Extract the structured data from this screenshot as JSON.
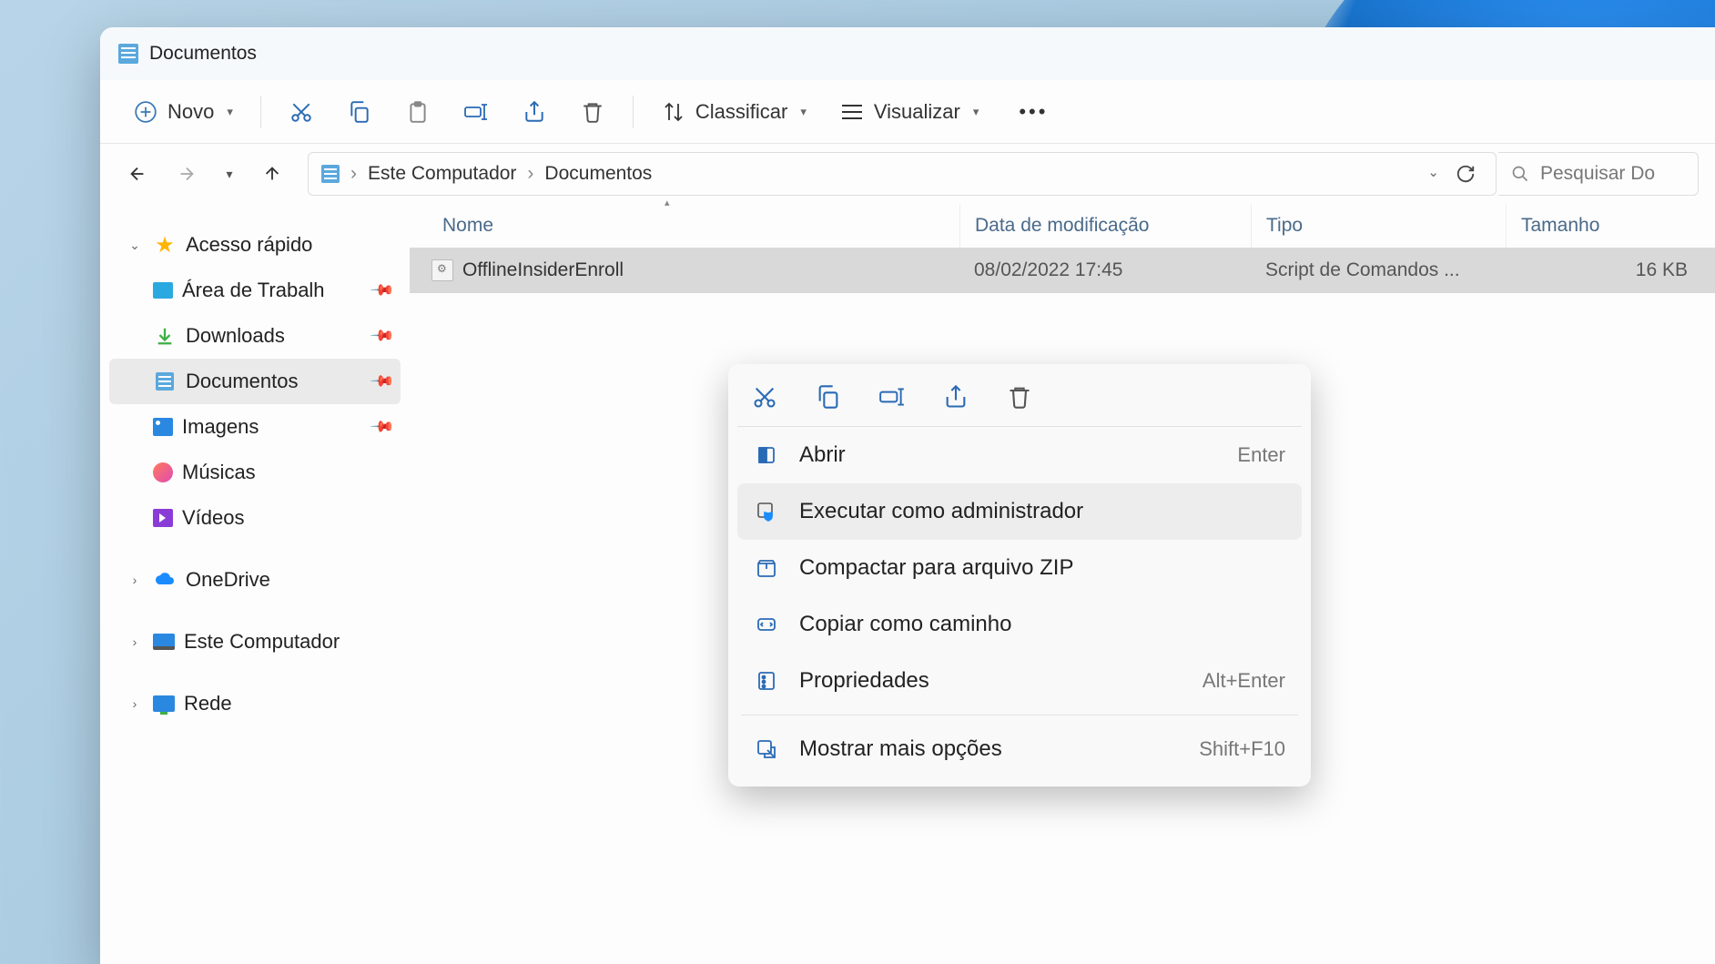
{
  "window_title": "Documentos",
  "toolbar": {
    "new_label": "Novo",
    "sort_label": "Classificar",
    "view_label": "Visualizar"
  },
  "breadcrumb": {
    "root": "Este Computador",
    "folder": "Documentos"
  },
  "search": {
    "placeholder": "Pesquisar Do"
  },
  "sidebar": {
    "quick_access": "Acesso rápido",
    "items": [
      {
        "label": "Área de Trabalh",
        "pinned": true
      },
      {
        "label": "Downloads",
        "pinned": true
      },
      {
        "label": "Documentos",
        "pinned": true,
        "active": true
      },
      {
        "label": "Imagens",
        "pinned": true
      },
      {
        "label": "Músicas",
        "pinned": false
      },
      {
        "label": "Vídeos",
        "pinned": false
      }
    ],
    "onedrive": "OneDrive",
    "thispc": "Este Computador",
    "network": "Rede"
  },
  "columns": {
    "name": "Nome",
    "date": "Data de modificação",
    "type": "Tipo",
    "size": "Tamanho"
  },
  "files": [
    {
      "name": "OfflineInsiderEnroll",
      "date": "08/02/2022 17:45",
      "type": "Script de Comandos ...",
      "size": "16 KB"
    }
  ],
  "context_menu": {
    "open": "Abrir",
    "open_shortcut": "Enter",
    "run_admin": "Executar como administrador",
    "compress": "Compactar para arquivo ZIP",
    "copy_path": "Copiar como caminho",
    "properties": "Propriedades",
    "properties_shortcut": "Alt+Enter",
    "more": "Mostrar mais opções",
    "more_shortcut": "Shift+F10"
  }
}
